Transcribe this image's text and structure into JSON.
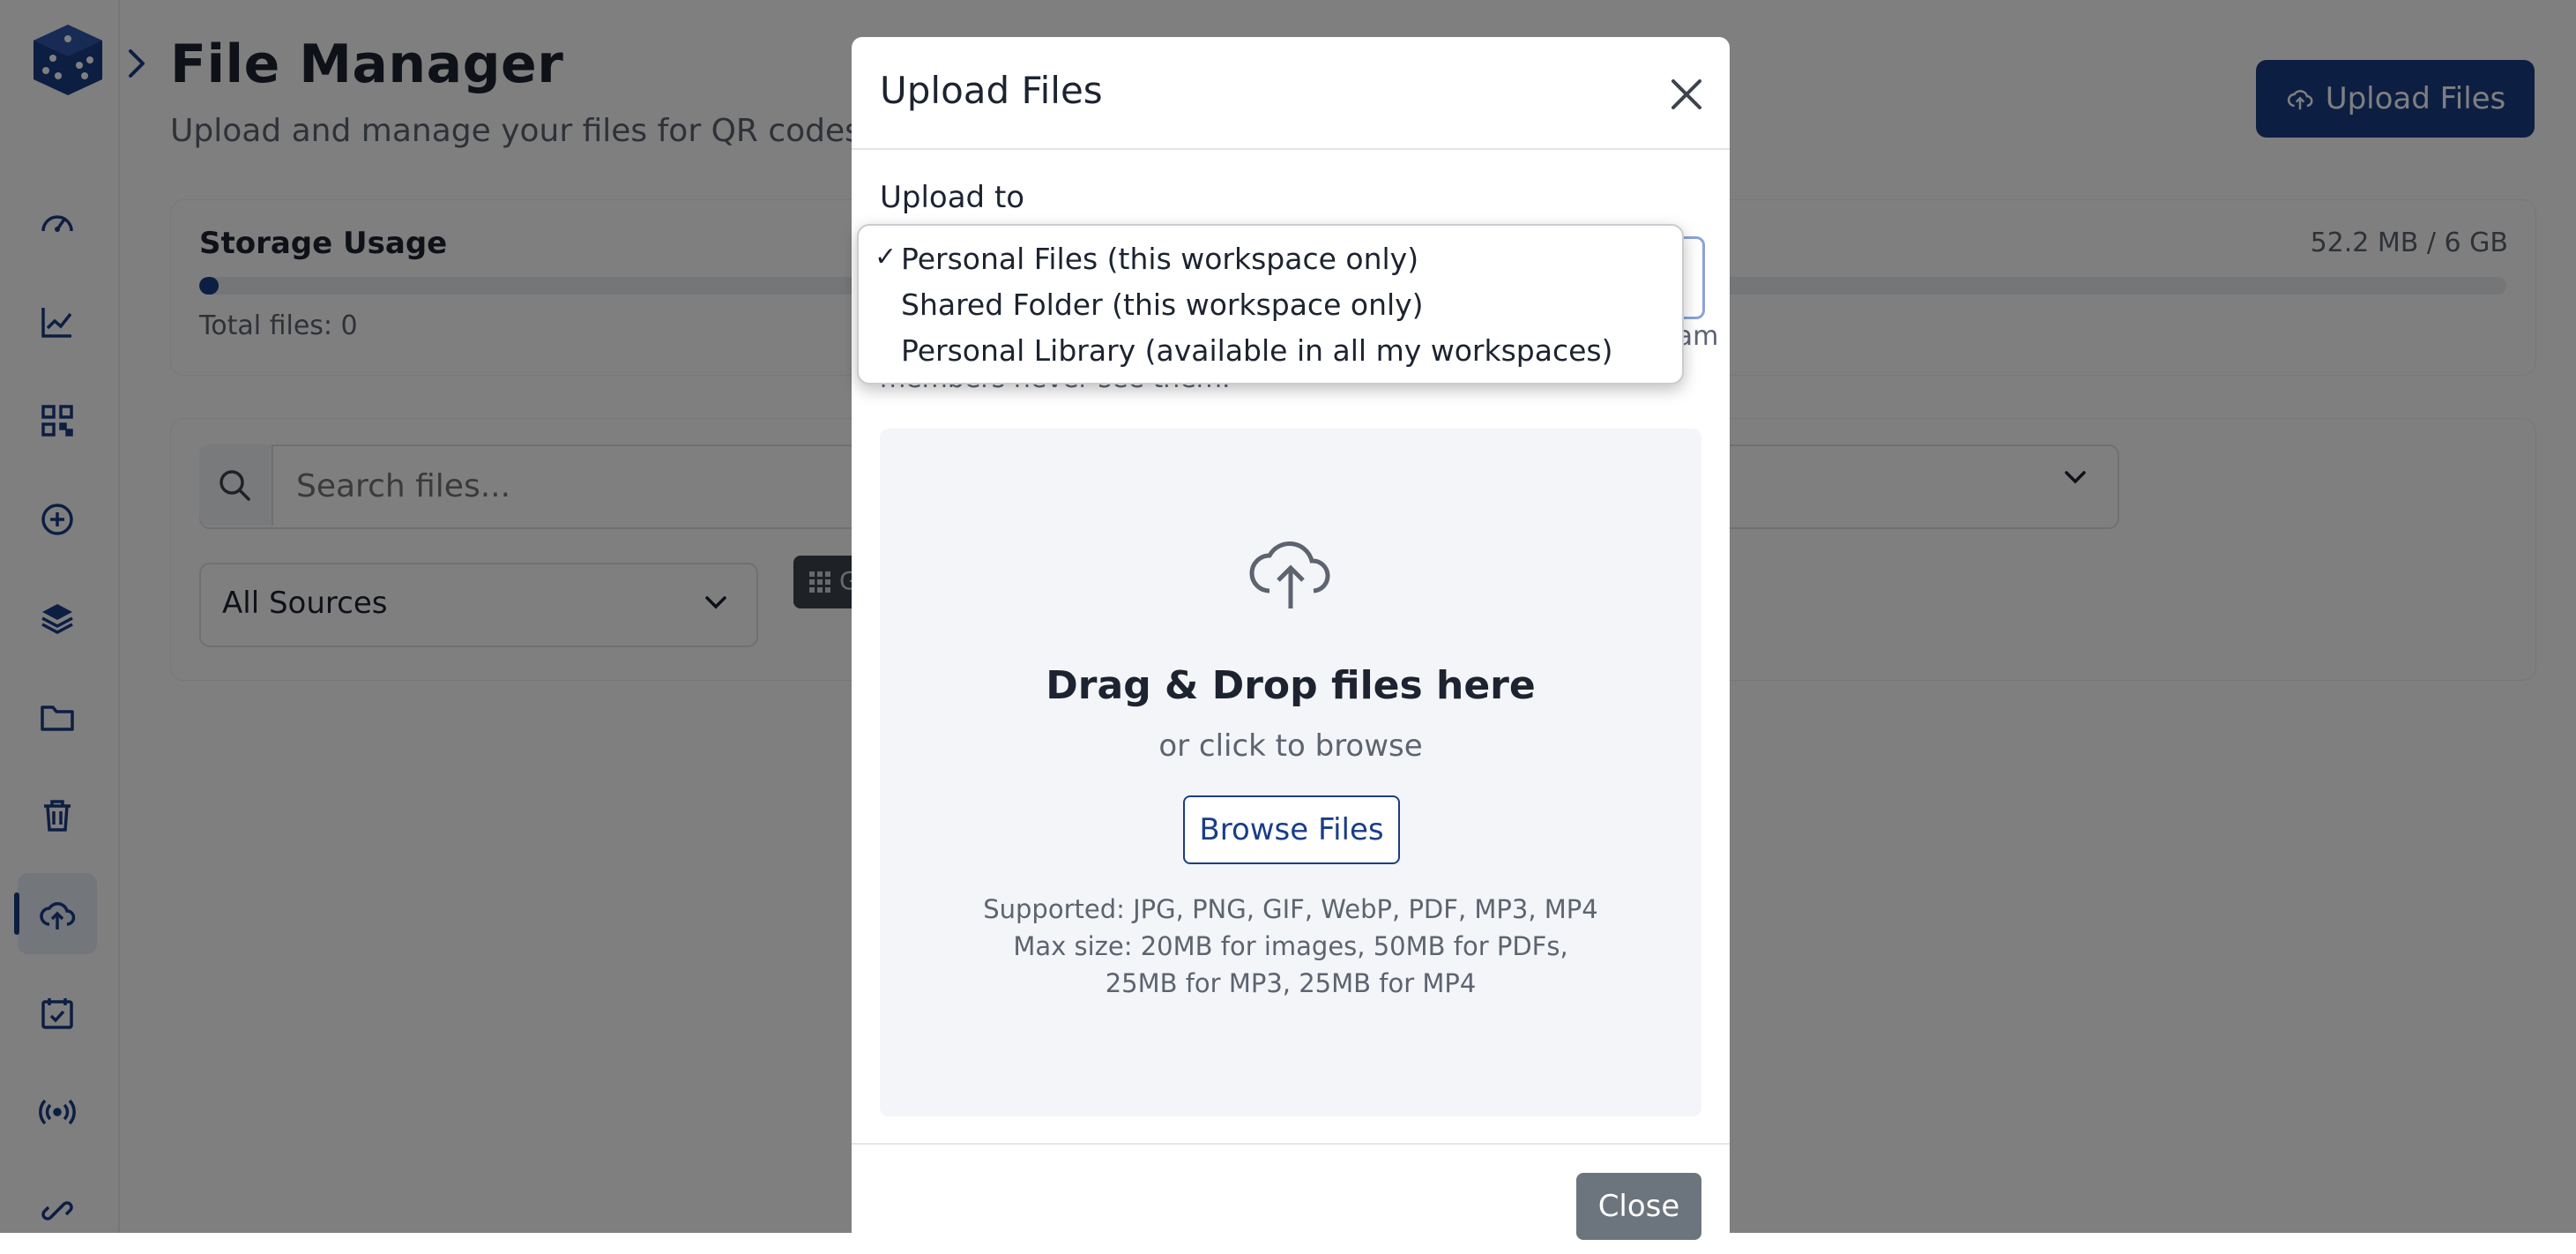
{
  "header": {
    "title": "File Manager",
    "subtitle": "Upload and manage your files for QR codes",
    "upload_button": "Upload Files"
  },
  "sidebar": {
    "items": [
      {
        "icon": "dashboard-gauge-icon"
      },
      {
        "icon": "analytics-chart-icon"
      },
      {
        "icon": "qr-code-icon"
      },
      {
        "icon": "add-circle-icon"
      },
      {
        "icon": "layers-icon"
      },
      {
        "icon": "folder-icon"
      },
      {
        "icon": "trash-icon"
      },
      {
        "icon": "cloud-upload-icon",
        "active": true
      },
      {
        "icon": "calendar-check-icon"
      },
      {
        "icon": "broadcast-icon"
      },
      {
        "icon": "link-icon"
      }
    ]
  },
  "storage": {
    "title": "Storage Usage",
    "used": "52.2 MB / 6 GB",
    "total_files": "Total files: 0",
    "percent_used": 0.85
  },
  "search": {
    "placeholder": "Search files...",
    "sources_value": "All Sources",
    "grid_label": "G"
  },
  "modal": {
    "title": "Upload Files",
    "upload_to_label": "Upload to",
    "help_text_visible": "members never see them.",
    "help_text_right": "Team",
    "drop_title": "Drag & Drop files here",
    "drop_sub": "or click to browse",
    "browse_button": "Browse Files",
    "supported": "Supported: JPG, PNG, GIF, WebP, PDF, MP3, MP4",
    "max_size": "Max size: 20MB for images, 50MB for PDFs, 25MB for MP3, 25MB for MP4",
    "close_button": "Close"
  },
  "dropdown": {
    "options": [
      {
        "label": "Personal Files (this workspace only)",
        "selected": true
      },
      {
        "label": "Shared Folder (this workspace only)",
        "selected": false
      },
      {
        "label": "Personal Library (available in all my workspaces)",
        "selected": false
      }
    ],
    "check_mark": "✓"
  },
  "colors": {
    "brand": "#1b3d87",
    "overlay": "rgba(0,0,0,0.5)",
    "close_button": "#6c757d"
  }
}
